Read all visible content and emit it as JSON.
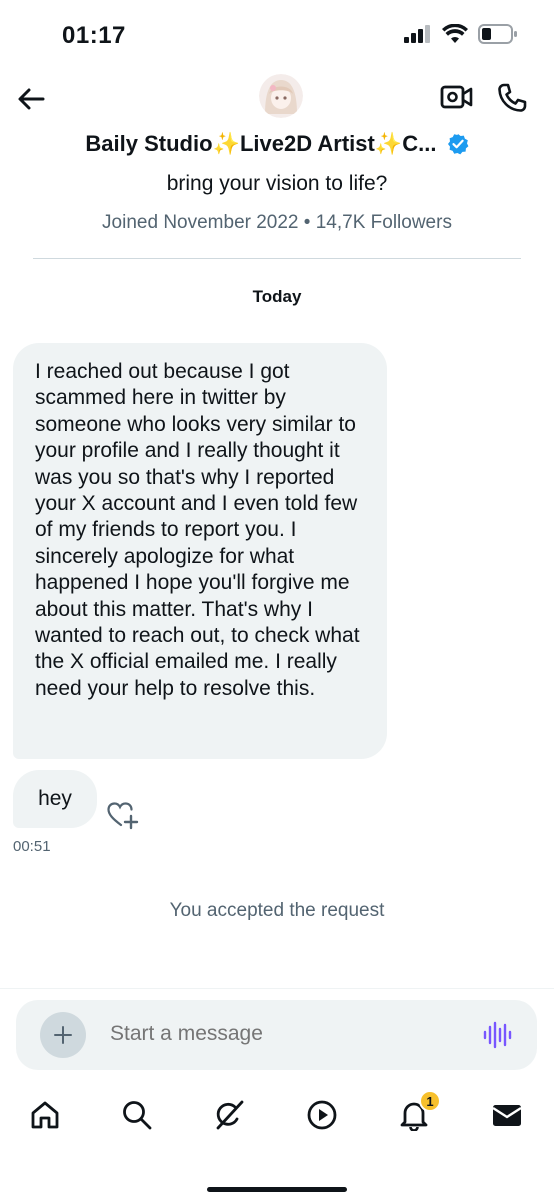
{
  "status_bar": {
    "time": "01:17"
  },
  "header": {
    "contact_name_part1": "Baily Studio",
    "contact_name_part2": "Live2D Artist",
    "contact_name_part3": "C...",
    "sparkle_glyph": "✨"
  },
  "profile": {
    "bio_tail": "bring your vision to life?",
    "joined": "Joined November 2022 • 14,7K Followers"
  },
  "conversation": {
    "date_separator": "Today",
    "messages": [
      {
        "text": "I reached out because I got scammed here in twitter by someone who looks very similar to your profile and I really thought it was you so that's why I reported your X account and I even told few of my friends to report you. I sincerely apologize for what happened I hope you'll forgive me about this matter. That's why I wanted to reach out, to check what the X official emailed me. I really need your help to resolve this."
      },
      {
        "text": "hey",
        "time": "00:51"
      }
    ],
    "system_note": "You accepted the request"
  },
  "composer": {
    "placeholder": "Start a message"
  },
  "tabbar": {
    "items": [
      "home-icon",
      "search-icon",
      "grok-icon",
      "video-icon",
      "notifications-icon",
      "messages-icon"
    ],
    "notification_count": "1"
  },
  "colors": {
    "accent": "#1d9bf0",
    "muted": "#536471",
    "bubble": "#eff3f4",
    "voice": "#7856ff",
    "badge": "#f7c02c"
  }
}
